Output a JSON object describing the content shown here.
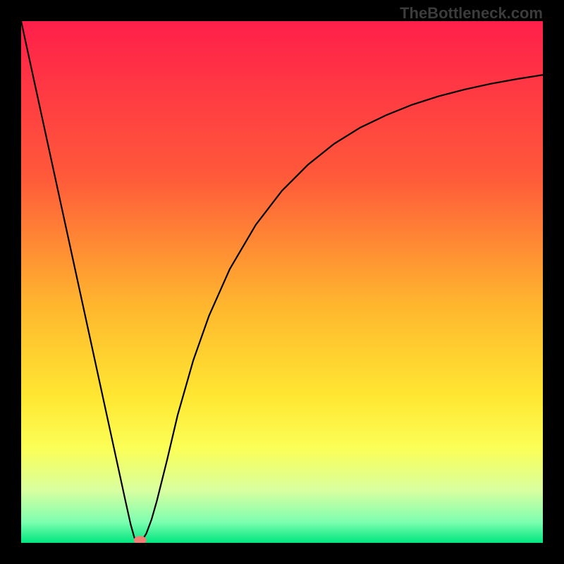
{
  "watermark": "TheBottleneck.com",
  "chart_data": {
    "type": "line",
    "title": "",
    "xlabel": "",
    "ylabel": "",
    "xlim": [
      0,
      100
    ],
    "ylim": [
      0,
      100
    ],
    "background_gradient": {
      "stops": [
        {
          "offset": 0.0,
          "color": "#ff1f4a"
        },
        {
          "offset": 0.3,
          "color": "#ff5a3a"
        },
        {
          "offset": 0.55,
          "color": "#ffb82e"
        },
        {
          "offset": 0.72,
          "color": "#ffe732"
        },
        {
          "offset": 0.82,
          "color": "#fbff57"
        },
        {
          "offset": 0.9,
          "color": "#d8ffa0"
        },
        {
          "offset": 0.96,
          "color": "#7dffb0"
        },
        {
          "offset": 1.0,
          "color": "#00e57f"
        }
      ]
    },
    "series": [
      {
        "name": "bottleneck-curve",
        "type": "line",
        "color": "#000000",
        "width": 2.2,
        "points": [
          {
            "x": 0.0,
            "y": 100.0
          },
          {
            "x": 2.5,
            "y": 88.5
          },
          {
            "x": 5.0,
            "y": 77.0
          },
          {
            "x": 7.5,
            "y": 65.5
          },
          {
            "x": 10.0,
            "y": 54.0
          },
          {
            "x": 12.5,
            "y": 42.5
          },
          {
            "x": 15.0,
            "y": 31.0
          },
          {
            "x": 17.5,
            "y": 19.5
          },
          {
            "x": 19.0,
            "y": 12.6
          },
          {
            "x": 20.0,
            "y": 8.0
          },
          {
            "x": 21.0,
            "y": 3.5
          },
          {
            "x": 21.7,
            "y": 1.0
          },
          {
            "x": 22.3,
            "y": 0.0
          },
          {
            "x": 23.0,
            "y": 0.2
          },
          {
            "x": 24.0,
            "y": 1.8
          },
          {
            "x": 25.0,
            "y": 4.5
          },
          {
            "x": 26.0,
            "y": 8.0
          },
          {
            "x": 28.0,
            "y": 16.0
          },
          {
            "x": 30.0,
            "y": 24.5
          },
          {
            "x": 33.0,
            "y": 35.0
          },
          {
            "x": 36.0,
            "y": 43.5
          },
          {
            "x": 40.0,
            "y": 52.5
          },
          {
            "x": 45.0,
            "y": 61.0
          },
          {
            "x": 50.0,
            "y": 67.5
          },
          {
            "x": 55.0,
            "y": 72.5
          },
          {
            "x": 60.0,
            "y": 76.5
          },
          {
            "x": 65.0,
            "y": 79.6
          },
          {
            "x": 70.0,
            "y": 82.0
          },
          {
            "x": 75.0,
            "y": 84.0
          },
          {
            "x": 80.0,
            "y": 85.6
          },
          {
            "x": 85.0,
            "y": 86.9
          },
          {
            "x": 90.0,
            "y": 88.0
          },
          {
            "x": 95.0,
            "y": 88.9
          },
          {
            "x": 100.0,
            "y": 89.7
          }
        ]
      }
    ],
    "markers": [
      {
        "name": "minimum-marker",
        "x": 22.8,
        "y": 0.5,
        "color": "#f08074",
        "rx": 9,
        "ry": 6
      }
    ]
  }
}
